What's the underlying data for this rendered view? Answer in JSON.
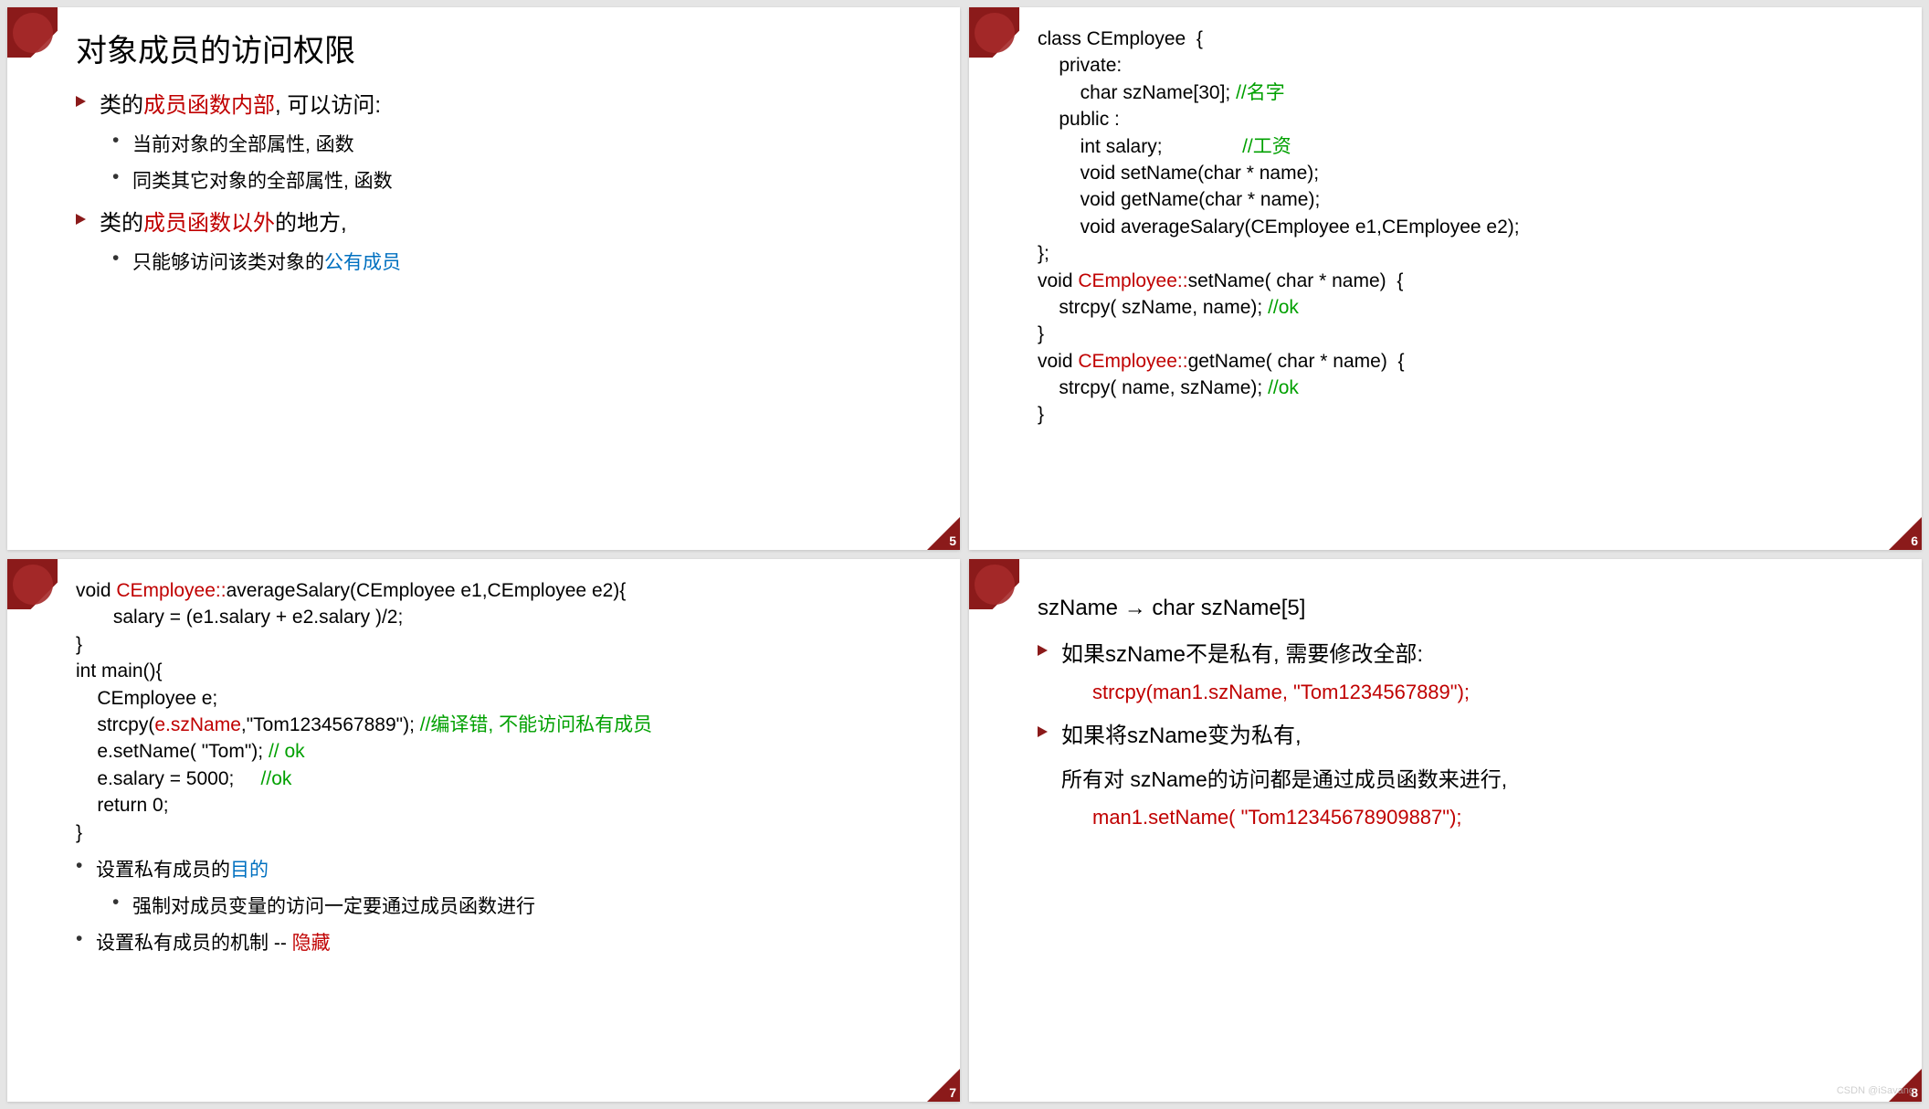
{
  "slide5": {
    "page": "5",
    "title": "对象成员的访问权限",
    "b1_pre": "类的",
    "b1_red": "成员函数内部",
    "b1_post": ", 可以访问:",
    "b1s1": "当前对象的全部属性, 函数",
    "b1s2": "同类其它对象的全部属性, 函数",
    "b2_pre": "类的",
    "b2_red": "成员函数以外",
    "b2_post": "的地方,",
    "b2s1_pre": "只能够访问该类对象的",
    "b2s1_blue": "公有成员"
  },
  "slide6": {
    "page": "6",
    "l1": "class CEmployee  {",
    "l2": "    private:",
    "l3_a": "        char szName[30]; ",
    "l3_c": "//名字",
    "l4": "    public :",
    "l5_a": "        int salary;               ",
    "l5_c": "//工资",
    "l6": "        void setName(char * name);",
    "l7": "        void getName(char * name);",
    "l8": "        void averageSalary(CEmployee e1,CEmployee e2);",
    "l9": "};",
    "l10_a": "void ",
    "l10_b": "CEmployee::",
    "l10_c": "setName( char * name)  {",
    "l11_a": "    strcpy( szName, name); ",
    "l11_c": "//ok",
    "l12": "}",
    "l13_a": "void ",
    "l13_b": "CEmployee::",
    "l13_c": "getName( char * name)  {",
    "l14_a": "    strcpy( name, szName); ",
    "l14_c": "//ok",
    "l15": "}"
  },
  "slide7": {
    "page": "7",
    "l1_a": "void ",
    "l1_b": "CEmployee::",
    "l1_c": "averageSalary(CEmployee e1,CEmployee e2){",
    "l2": "       salary = (e1.salary + e2.salary )/2;",
    "l3": "}",
    "l4": "int main(){",
    "l5": "    CEmployee e;",
    "l6_a": "    strcpy(",
    "l6_b": "e.szName",
    "l6_c": ",\"Tom1234567889\"); ",
    "l6_d": "//编译错, 不能访问私有成员",
    "l7_a": "    e.setName( \"Tom\"); ",
    "l7_c": "// ok",
    "l8_a": "    e.salary = 5000;     ",
    "l8_c": "//ok",
    "l9": "    return 0;",
    "l10": "}",
    "b1_pre": "设置私有成员的",
    "b1_blue": "目的",
    "b1s1": "强制对成员变量的访问一定要通过成员函数进行",
    "b2_pre": "设置私有成员的机制 -- ",
    "b2_red": "隐藏"
  },
  "slide8": {
    "page": "8",
    "heading": "szName → char szName[5]",
    "b1": "如果szName不是私有, 需要修改全部:",
    "b1_code": "strcpy(man1.szName, \"Tom1234567889\");",
    "b2": "如果将szName变为私有,",
    "b2_line2": "所有对 szName的访问都是通过成员函数来进行,",
    "b2_code": "man1.setName( \"Tom12345678909887\");"
  },
  "watermark": "CSDN @iSavang"
}
